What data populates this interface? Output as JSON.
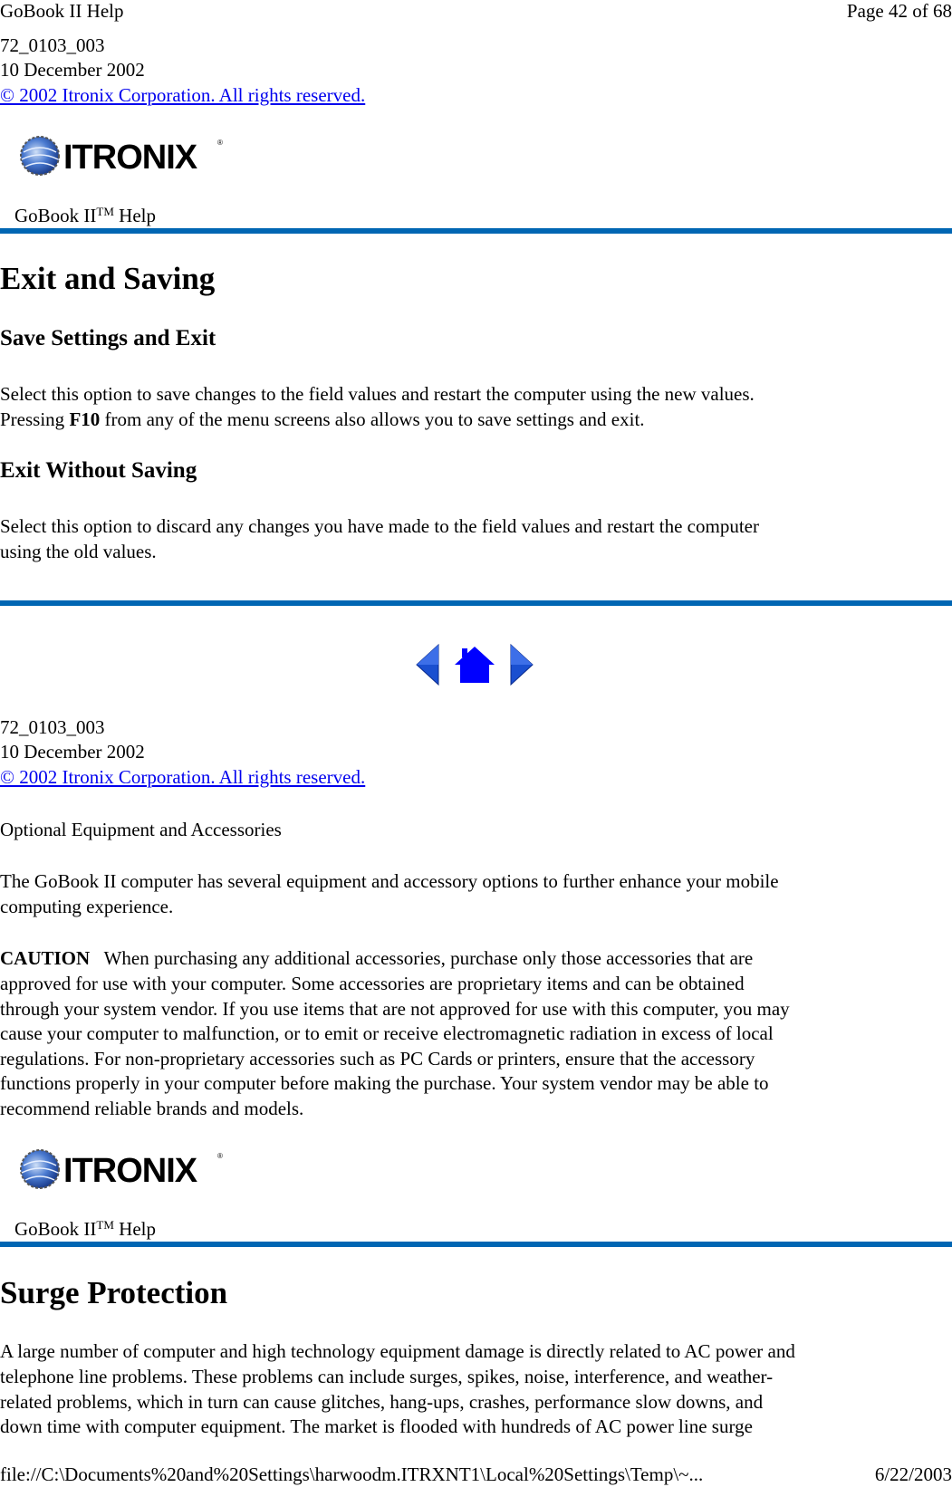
{
  "print_header": {
    "title": "GoBook II Help",
    "page": "Page 42 of 68"
  },
  "colors": {
    "rule": "#0066b3",
    "link": "#0000ee",
    "nav_icon": "#1a3fd6"
  },
  "top_meta": {
    "doc_id": "72_0103_003",
    "date": "10 December 2002",
    "copyright": "© 2002 Itronix Corporation.  All rights reserved."
  },
  "banner": {
    "logo_text": "ITRONIX",
    "logo_mark": "®",
    "help_prefix": "GoBook II",
    "help_tm": "TM",
    "help_suffix": " Help"
  },
  "section1": {
    "title": "Exit and Saving",
    "items": [
      {
        "heading": "Save Settings and Exit",
        "line1": "Select this option to save changes to the field values and restart the computer using the new values.",
        "line2_pre": " Pressing ",
        "line2_key": "F10",
        "line2_post": " from any of the menu screens also allows you to save settings and exit."
      },
      {
        "heading": "Exit Without Saving",
        "line1": "Select this option to discard any changes you have made to the field values and restart the computer",
        "line2": "using the old values."
      }
    ]
  },
  "nav": {
    "prev": "previous-page",
    "home": "home",
    "next": "next-page"
  },
  "mid_meta": {
    "doc_id": "72_0103_003",
    "date": "10 December 2002",
    "copyright": "© 2002 Itronix Corporation.  All rights reserved."
  },
  "section2": {
    "title": "Optional Equipment and Accessories",
    "intro_lines": [
      "The GoBook II computer has several equipment and accessory options to further enhance your mobile",
      "computing experience."
    ],
    "caution_label": "CAUTION",
    "caution_first": "When purchasing any additional accessories, purchase only those accessories that are",
    "caution_lines": [
      "approved for use with your computer. Some accessories are proprietary items and can be obtained",
      "through your system vendor. If you use items that are not approved for use with this computer, you may",
      "cause your computer to malfunction, or to emit or receive electromagnetic radiation in excess of local",
      "regulations. For non-proprietary accessories such as PC Cards or printers, ensure that the accessory",
      "functions properly in your computer before making the purchase. Your system vendor may be able to",
      "recommend reliable brands and models."
    ]
  },
  "section3": {
    "title": "Surge Protection",
    "lines": [
      "A large number of computer and high technology equipment damage is directly related to AC power and",
      "telephone line problems. These problems can include surges, spikes, noise, interference, and weather-",
      "related problems, which in turn can cause glitches, hang-ups, crashes, performance slow downs, and",
      "down time with computer equipment. The market is flooded with hundreds of AC power line surge"
    ]
  },
  "print_footer": {
    "path": "file://C:\\Documents%20and%20Settings\\harwoodm.ITRXNT1\\Local%20Settings\\Temp\\~...",
    "date": "6/22/2003"
  }
}
